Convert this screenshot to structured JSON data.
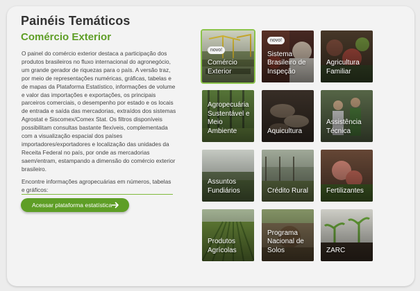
{
  "header": {
    "title": "Painéis Temáticos",
    "subtitle": "Comércio Exterior"
  },
  "description": "O painel do comércio exterior destaca a participação dos produtos brasileiros no fluxo internacional do agronegócio, um grande gerador de riquezas para o país. A versão traz, por meio de representações numéricas, gráficas, tabelas e de mapas da Plataforma Estatístico, informações de volume e valor das importações e exportações, os principais parceiros comerciais, o desempenho por estado e os locais de entrada e saída das mercadorias, extraídos dos sistemas Agrostat e Siscomex/Comex Stat. Os filtros disponíveis possibilitam consultas bastante flexíveis, complementada com a visualização espacial dos países importadores/exportadores e localização das unidades da Receita Federal no país, por onde as mercadorias saem/entram, estampando a dimensão do comércio exterior brasileiro.",
  "find_text": "Encontre informações agropecuárias em números, tabelas e gráficos:",
  "cta": {
    "label": "Acessar plataforma estatística",
    "icon": "arrow-right-icon"
  },
  "badge_label": "novo!",
  "tiles": [
    {
      "label": "Comércio Exterior",
      "badge": true,
      "selected": true
    },
    {
      "label": "Sistema Brasileiro de Inspeção",
      "badge": true
    },
    {
      "label": "Agricultura Familiar"
    },
    {
      "label": "Agropecuária Sustentável e Meio Ambiente"
    },
    {
      "label": "Aquicultura"
    },
    {
      "label": "Assistência Técnica"
    },
    {
      "label": "Assuntos Fundiários"
    },
    {
      "label": "Crédito Rural"
    },
    {
      "label": "Fertilizantes"
    },
    {
      "label": "Produtos Agrícolas"
    },
    {
      "label": "Programa Nacional de Solos"
    },
    {
      "label": "ZARC"
    }
  ],
  "colors": {
    "accent": "#5e9e26",
    "title": "#333333",
    "selected_outline": "#8bc34a"
  }
}
